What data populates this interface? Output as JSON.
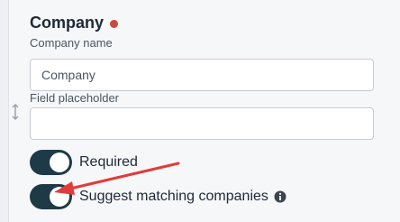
{
  "field": {
    "title": "Company",
    "required_dot_color": "#c94a3a",
    "name_label": "Company name",
    "name_value": "Company",
    "placeholder_label": "Field placeholder",
    "placeholder_value": ""
  },
  "toggles": [
    {
      "label": "Required",
      "checked": true
    },
    {
      "label": "Suggest matching companies",
      "checked": true,
      "icon": "info-icon"
    }
  ],
  "colors": {
    "toggle_on": "#1e3a46",
    "annotation_arrow": "#e23b3b"
  },
  "icons": {
    "drag": "vertical-resize-icon"
  }
}
